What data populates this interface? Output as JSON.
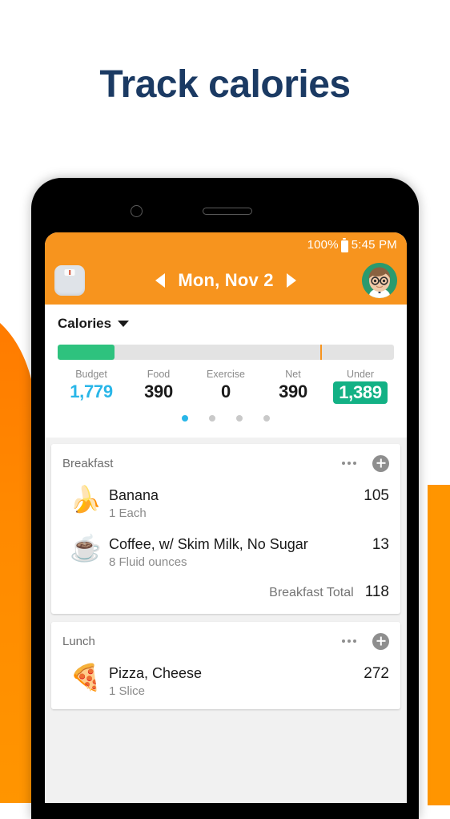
{
  "headline": "Track calories",
  "phone": {
    "status_bar": {
      "battery_percent": "100%",
      "time": "5:45 PM"
    },
    "app_bar": {
      "scale_icon": "scale-icon",
      "prev_label": "◀",
      "date": "Mon, Nov 2",
      "next_label": "▶",
      "avatar": "user-avatar"
    },
    "summary": {
      "section_label": "Calories",
      "progress": {
        "fill_percent": 17,
        "marker_percent": 78
      },
      "stats": [
        {
          "name": "Budget",
          "value": "1,779",
          "style": "accent"
        },
        {
          "name": "Food",
          "value": "390",
          "style": "plain"
        },
        {
          "name": "Exercise",
          "value": "0",
          "style": "plain"
        },
        {
          "name": "Net",
          "value": "390",
          "style": "plain"
        },
        {
          "name": "Under",
          "value": "1,389",
          "style": "badge"
        }
      ],
      "pager": {
        "count": 4,
        "active_index": 0
      }
    },
    "meals": [
      {
        "title": "Breakfast",
        "menu_icon": "overflow-menu-icon",
        "add_icon": "add-food-icon",
        "items": [
          {
            "emoji": "🍌",
            "emoji_name": "banana-icon",
            "name": "Banana",
            "serving": "1 Each",
            "calories": "105"
          },
          {
            "emoji": "☕",
            "emoji_name": "coffee-cup-icon",
            "name": "Coffee, w/ Skim Milk, No Sugar",
            "serving": "8 Fluid ounces",
            "calories": "13"
          }
        ],
        "total_label": "Breakfast Total",
        "total_value": "118"
      },
      {
        "title": "Lunch",
        "menu_icon": "overflow-menu-icon",
        "add_icon": "add-food-icon",
        "items": [
          {
            "emoji": "🍕",
            "emoji_name": "pizza-slice-icon",
            "name": "Pizza, Cheese",
            "serving": "1 Slice",
            "calories": "272"
          }
        ],
        "total_label": "",
        "total_value": ""
      }
    ]
  },
  "colors": {
    "brand_orange": "#F7941E",
    "deco_orange": "#FF9500",
    "headline_navy": "#1b3a63",
    "accent_cyan": "#29b6e8",
    "under_green": "#13b185",
    "progress_green": "#2ec27e"
  }
}
